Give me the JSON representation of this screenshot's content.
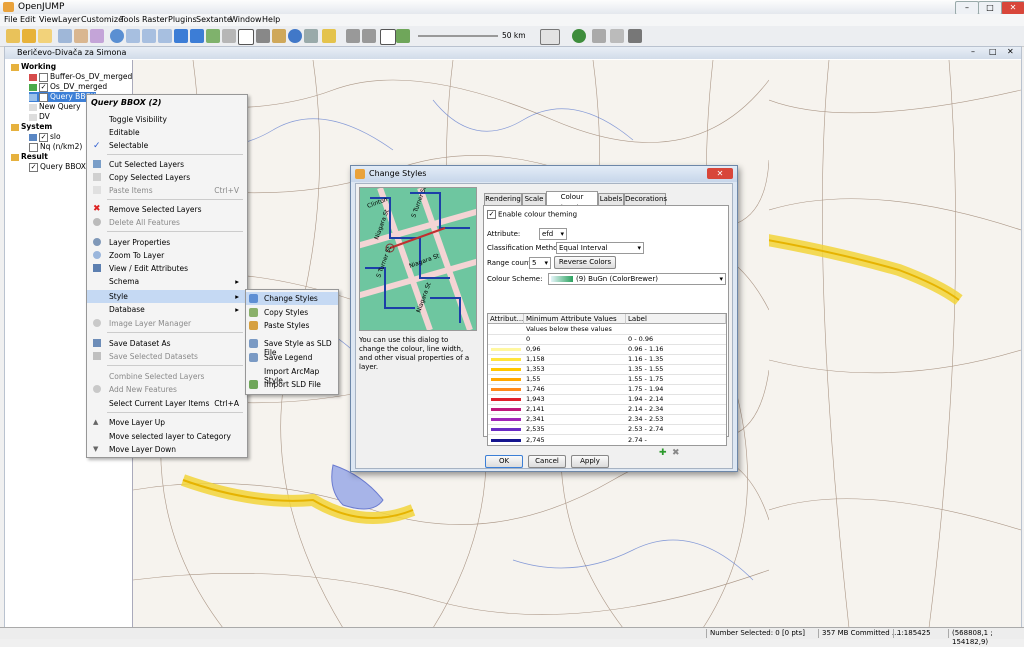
{
  "window": {
    "title": "OpenJUMP",
    "controls": [
      "–",
      "□",
      "✕"
    ]
  },
  "menubar": [
    "File",
    "Edit",
    "View",
    "Layer",
    "Customize",
    "Tools",
    "Raster",
    "Plugins",
    "Sextante",
    "Window",
    "Help"
  ],
  "toolbar": {
    "scale_text": "50 km"
  },
  "taskframe": {
    "title": "Beričevo-Divača za Simona",
    "controls": [
      "–",
      "□",
      "✕"
    ]
  },
  "layer_tree": {
    "categories": [
      {
        "name": "Working",
        "layers": [
          "Buffer-Os_DV_merged",
          "Os_DV_merged",
          "Query BBOX",
          "New Query",
          "DV"
        ]
      },
      {
        "name": "System",
        "layers": [
          "slo",
          "Nq (n/km2)"
        ]
      },
      {
        "name": "Result",
        "layers": [
          "Query BBOX"
        ]
      }
    ]
  },
  "context_menu": {
    "header": "Query BBOX (2)",
    "items": [
      {
        "label": "Toggle Visibility",
        "shortcut": "",
        "enabled": true
      },
      {
        "label": "Editable",
        "shortcut": "",
        "enabled": true
      },
      {
        "label": "Selectable",
        "shortcut": "",
        "enabled": true,
        "checked": true
      },
      {
        "label": "Cut Selected Layers",
        "shortcut": "",
        "enabled": true
      },
      {
        "label": "Copy Selected Layers",
        "shortcut": "",
        "enabled": true
      },
      {
        "label": "Paste Items",
        "shortcut": "Ctrl+V",
        "enabled": false
      },
      {
        "label": "Remove Selected Layers",
        "shortcut": "",
        "enabled": true
      },
      {
        "label": "Delete All Features",
        "shortcut": "",
        "enabled": false
      },
      {
        "label": "Layer Properties",
        "shortcut": "",
        "enabled": true
      },
      {
        "label": "Zoom To Layer",
        "shortcut": "",
        "enabled": true
      },
      {
        "label": "View / Edit Attributes",
        "shortcut": "",
        "enabled": true
      },
      {
        "label": "Schema",
        "shortcut": "",
        "enabled": true,
        "submenu": true
      },
      {
        "label": "Style",
        "shortcut": "",
        "enabled": true,
        "submenu": true,
        "highlighted": true
      },
      {
        "label": "Database",
        "shortcut": "",
        "enabled": true,
        "submenu": true
      },
      {
        "label": "Image Layer Manager",
        "shortcut": "",
        "enabled": false
      },
      {
        "label": "Save Dataset As",
        "shortcut": "",
        "enabled": true
      },
      {
        "label": "Save Selected Datasets",
        "shortcut": "",
        "enabled": false
      },
      {
        "label": "Combine Selected Layers",
        "shortcut": "",
        "enabled": false
      },
      {
        "label": "Add New Features",
        "shortcut": "",
        "enabled": false
      },
      {
        "label": "Select Current Layer Items",
        "shortcut": "Ctrl+A",
        "enabled": true
      },
      {
        "label": "Move Layer Up",
        "shortcut": "",
        "enabled": true
      },
      {
        "label": "Move selected layer to Category",
        "shortcut": "",
        "enabled": true
      },
      {
        "label": "Move Layer Down",
        "shortcut": "",
        "enabled": true
      }
    ]
  },
  "style_submenu": [
    "Change Styles",
    "Copy Styles",
    "Paste Styles",
    "Save Style as SLD File",
    "Save Legend",
    "Import ArcMap Style",
    "Import SLD File"
  ],
  "dialog": {
    "title": "Change Styles",
    "preview_streets": [
      "Clinton",
      "Niagara St",
      "S Turner St",
      "S Turner St",
      "Niagara St",
      "Niagara St"
    ],
    "description": "You can use this dialog to change the colour, line width, and other visual properties of a layer.",
    "tabs": [
      "Rendering",
      "Scale",
      "Colour Theming",
      "Labels",
      "Decorations"
    ],
    "active_tab": "Colour Theming",
    "enable_label": "Enable colour theming",
    "attribute_label": "Attribute:",
    "attribute_value": "efd",
    "method_label": "Classification Method:",
    "method_value": "Equal Interval",
    "range_label": "Range count:",
    "range_value": "5",
    "reverse_button": "Reverse Colors",
    "scheme_label": "Colour Scheme:",
    "scheme_value": "(9) BuGn (ColorBrewer)",
    "table": {
      "headers": [
        "Attribut...",
        "Minimum Attribute Values",
        "Label"
      ],
      "below_row": "Values below these values",
      "rows": [
        {
          "value": "0",
          "label": "0 - 0.96",
          "color": ""
        },
        {
          "value": "0,96",
          "label": "0.96 - 1.16",
          "color": "#fff7a0"
        },
        {
          "value": "1,158",
          "label": "1.16 - 1.35",
          "color": "#ffe43d"
        },
        {
          "value": "1,353",
          "label": "1.35 - 1.55",
          "color": "#ffc700"
        },
        {
          "value": "1,55",
          "label": "1.55 - 1.75",
          "color": "#ffa800"
        },
        {
          "value": "1,746",
          "label": "1.75 - 1.94",
          "color": "#ff8a1a"
        },
        {
          "value": "1,943",
          "label": "1.94 - 2.14",
          "color": "#e0202a"
        },
        {
          "value": "2,141",
          "label": "2.14 - 2.34",
          "color": "#c0187a"
        },
        {
          "value": "2,341",
          "label": "2.34 - 2.53",
          "color": "#a025b8"
        },
        {
          "value": "2,535",
          "label": "2.53 - 2.74",
          "color": "#6a2bc4"
        },
        {
          "value": "2,745",
          "label": "2.74 -",
          "color": "#15158f"
        }
      ]
    },
    "buttons": {
      "ok": "OK",
      "cancel": "Cancel",
      "apply": "Apply"
    }
  },
  "statusbar": {
    "selected": "Number Selected: 0 [0 pts]",
    "memory": "357 MB Committed ...",
    "scale": "1:185425",
    "coords": "(568808,1 ; 154182,9)"
  }
}
